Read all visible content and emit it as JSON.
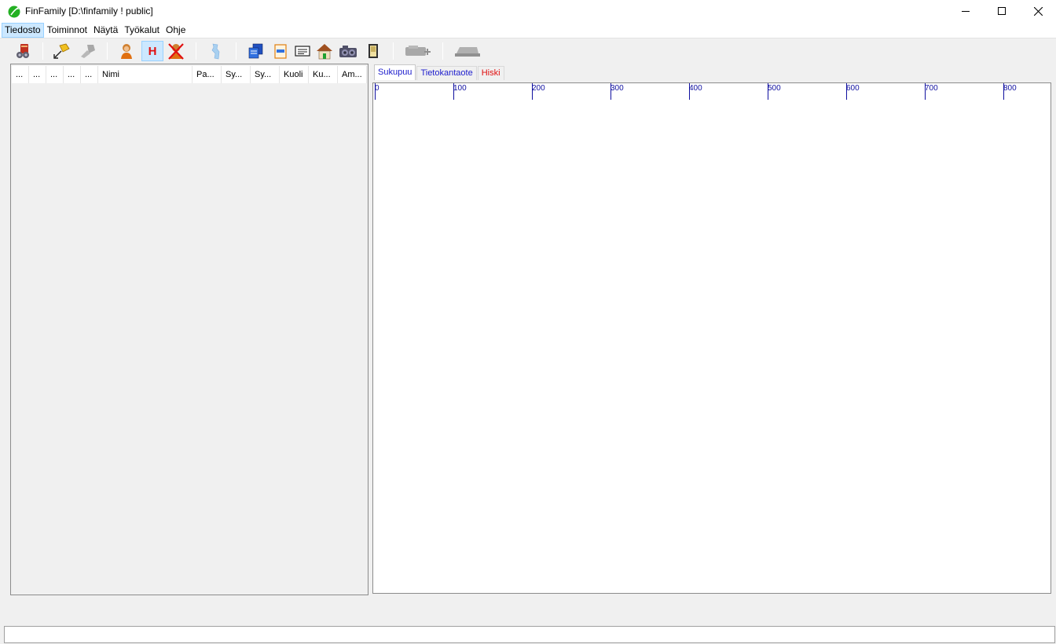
{
  "window": {
    "title": "FinFamily [D:\\finfamily ! public]",
    "icon": "finfamily-leaf-icon",
    "controls": [
      "minimize-icon",
      "maximize-icon",
      "close-icon"
    ]
  },
  "menu": {
    "items": [
      {
        "label": "Tiedosto",
        "active": true
      },
      {
        "label": "Toiminnot",
        "active": false
      },
      {
        "label": "Näytä",
        "active": false
      },
      {
        "label": "Työkalut",
        "active": false
      },
      {
        "label": "Ohje",
        "active": false
      }
    ]
  },
  "toolbar": {
    "buttons": [
      {
        "icon": "open-database-icon"
      },
      {
        "icon": "pin-import-icon"
      },
      {
        "icon": "disabled-tool-icon"
      },
      {
        "icon": "person-icon"
      },
      {
        "icon": "h-icon",
        "glyph": "H",
        "pressed": true
      },
      {
        "icon": "delete-person-icon"
      },
      {
        "icon": "map-icon"
      },
      {
        "icon": "copy-icon"
      },
      {
        "icon": "document-icon"
      },
      {
        "icon": "card-icon"
      },
      {
        "icon": "house-icon"
      },
      {
        "icon": "camera-icon"
      },
      {
        "icon": "door-icon"
      },
      {
        "icon": "disabled-add-icon"
      },
      {
        "icon": "disabled-remove-icon"
      }
    ]
  },
  "list": {
    "columns": [
      "...",
      "...",
      "...",
      "...",
      "...",
      "Nimi",
      "Pa...",
      "Sy...",
      "Sy...",
      "Kuoli",
      "Ku...",
      "Am..."
    ]
  },
  "tabs": [
    {
      "label": "Sukupuu",
      "active": true
    },
    {
      "label": "Tietokantaote",
      "active": false
    },
    {
      "label": "Hiski",
      "active": false
    }
  ],
  "ruler": {
    "labels": [
      "0",
      "100",
      "200",
      "300",
      "400",
      "500",
      "600",
      "700",
      "800"
    ],
    "color": "#1010a0"
  },
  "colors": {
    "menu_active": "#cce8ff",
    "tab_text": "#1c1ccc",
    "hiski_text": "#e01010"
  }
}
